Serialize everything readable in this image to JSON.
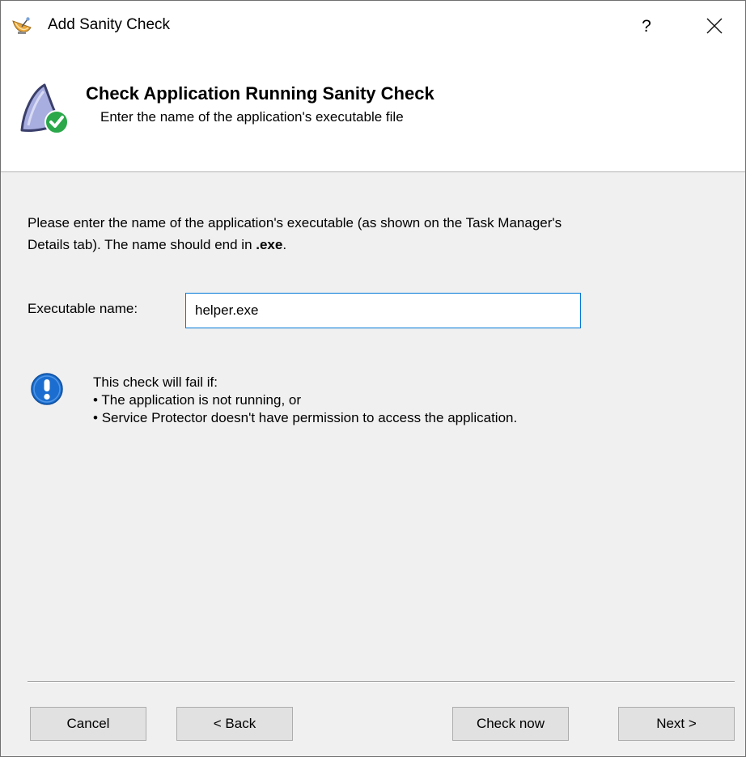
{
  "window": {
    "title": "Add Sanity Check",
    "help_label": "?",
    "app_icon": "satellite-dish-icon",
    "close_icon": "close-icon"
  },
  "header": {
    "title": "Check Application Running Sanity Check",
    "subtitle": "Enter the name of the application's executable file",
    "icon": "application-check-icon"
  },
  "content": {
    "description": {
      "line1": "Please enter the name of the application's executable (as shown on the Task Manager's",
      "line2_prefix": "Details tab). The name should end in ",
      "line2_bold": ".exe",
      "line2_suffix": "."
    },
    "field": {
      "label": "Executable name:",
      "value": "helper.exe"
    },
    "info": {
      "icon": "exclamation-info-icon",
      "heading": "This check will fail if:",
      "bullets": [
        "The application is not running, or",
        "Service Protector doesn't have permission to access the application."
      ]
    }
  },
  "buttons": {
    "cancel": "Cancel",
    "back": "< Back",
    "check_now": "Check now",
    "next": "Next >"
  },
  "colors": {
    "accent": "#0078d7",
    "info_blue": "#1b6ecf",
    "check_green": "#2aa84a",
    "button_bg": "#e1e1e1",
    "dialog_bg": "#f0f0f0"
  }
}
